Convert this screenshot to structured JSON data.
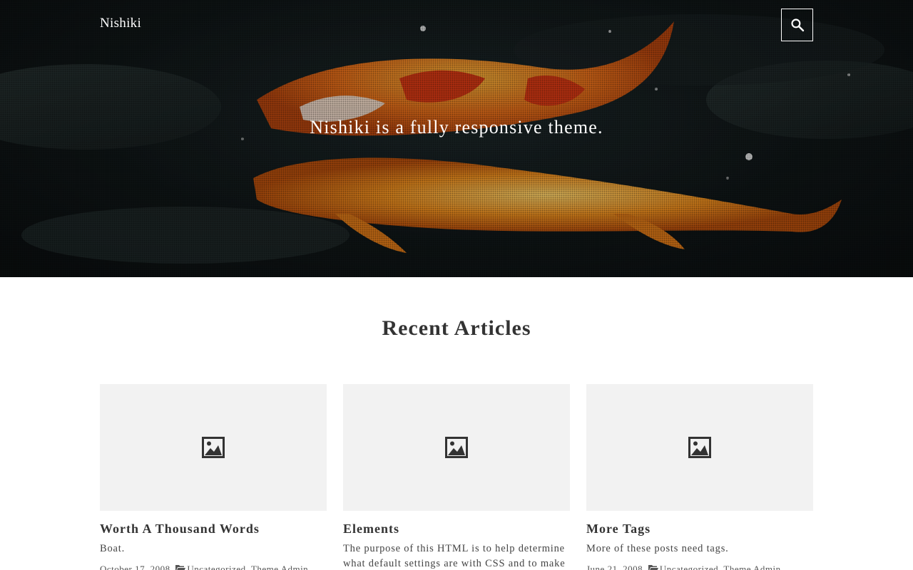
{
  "header": {
    "site_title": "Nishiki",
    "tagline": "Nishiki is a fully responsive theme.",
    "search_icon": "search-icon"
  },
  "main": {
    "section_title": "Recent Articles",
    "articles": [
      {
        "title": "Worth A Thousand Words",
        "excerpt": "Boat.",
        "date": "October 17, 2008",
        "categories": "Uncategorized",
        "author": "Theme Admin"
      },
      {
        "title": "Elements",
        "excerpt": "The purpose of this HTML is to help determine what default settings are with CSS and to make",
        "date": "",
        "categories": "",
        "author": ""
      },
      {
        "title": "More Tags",
        "excerpt": "More of these posts need tags.",
        "date": "June 21, 2008",
        "categories": "Uncategorized",
        "author": "Theme Admin"
      }
    ]
  },
  "colors": {
    "text": "#333333",
    "thumb_bg": "#f2f2f2",
    "hero_bg": "#101617",
    "koi_orange": "#e8701a",
    "koi_red": "#d93a14"
  }
}
